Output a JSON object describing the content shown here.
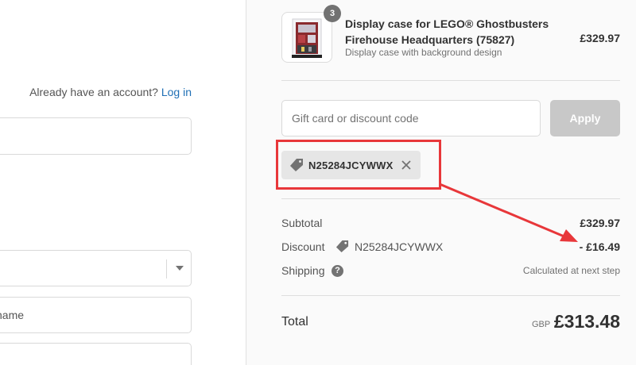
{
  "account": {
    "prompt": "Already have an account?",
    "login_link": "Log in"
  },
  "form": {
    "name_placeholder": "name"
  },
  "product": {
    "quantity": "3",
    "title": "Display case for LEGO® Ghostbusters Firehouse Headquarters (75827)",
    "subtitle": "Display case with background design",
    "price": "£329.97"
  },
  "discount_form": {
    "placeholder": "Gift card or discount code",
    "apply_label": "Apply"
  },
  "applied_code": {
    "code": "N25284JCYWWX"
  },
  "summary": {
    "subtotal_label": "Subtotal",
    "subtotal_value": "£329.97",
    "discount_label": "Discount",
    "discount_code": "N25284JCYWWX",
    "discount_value": "- £16.49",
    "shipping_label": "Shipping",
    "shipping_value": "Calculated at next step",
    "total_label": "Total",
    "currency": "GBP",
    "total_value": "£313.48"
  },
  "colors": {
    "highlight": "#e8373a",
    "link": "#1f6fb5",
    "apply_disabled": "#c8c8c8"
  },
  "icons": {
    "tag": "tag-icon",
    "remove": "close-icon",
    "help": "question-icon",
    "select": "chevron-down-icon"
  }
}
